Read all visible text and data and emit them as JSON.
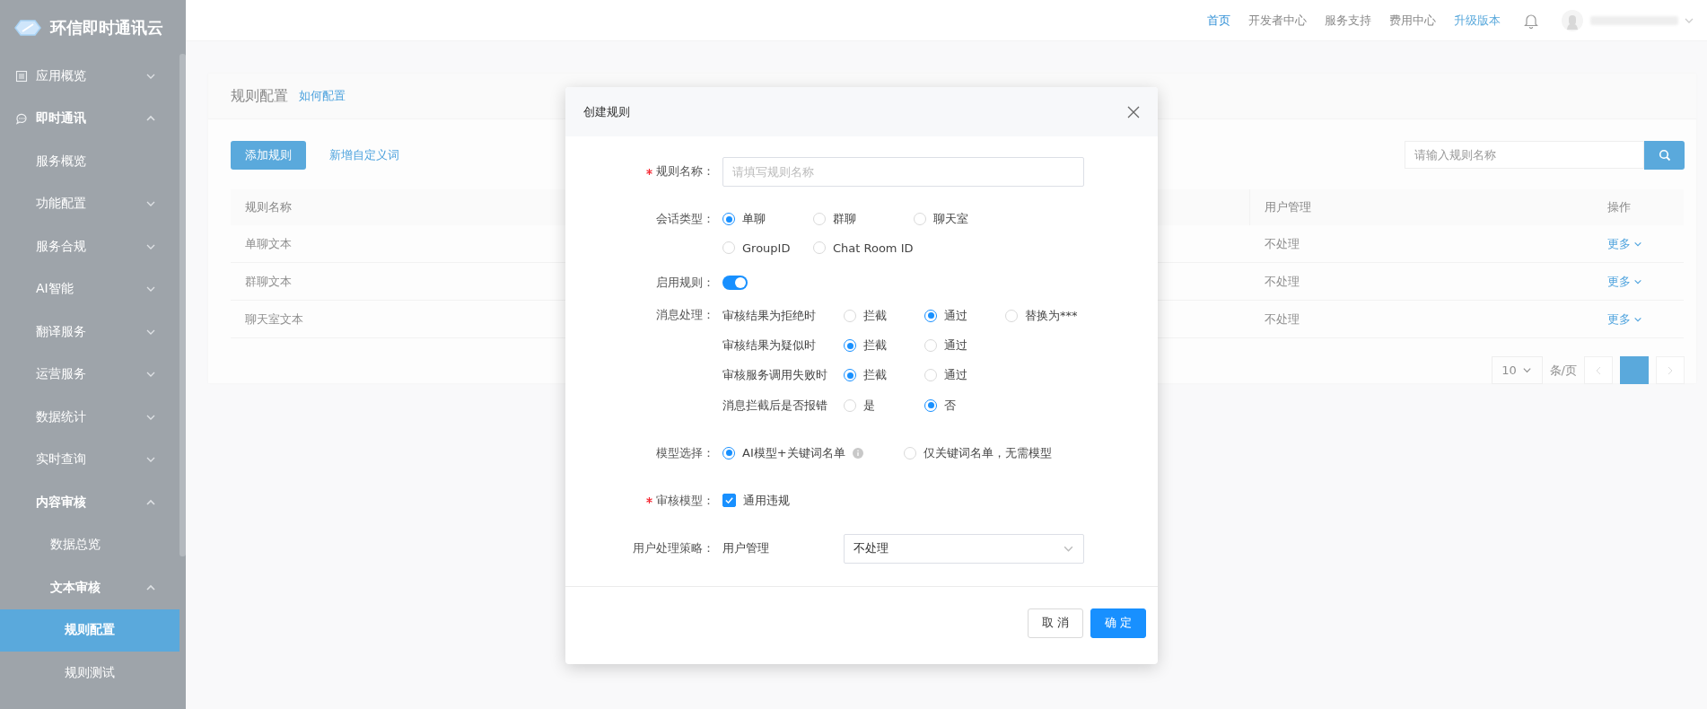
{
  "brand": {
    "name": "环信即时通讯云"
  },
  "sidebar": {
    "items": [
      {
        "label": "应用概览",
        "expanded": false,
        "selected": false
      },
      {
        "label": "即时通讯",
        "expanded": true,
        "selected": false,
        "children": [
          {
            "label": "服务概览",
            "selected": false
          },
          {
            "label": "功能配置",
            "expanded": false,
            "selected": false
          },
          {
            "label": "服务合规",
            "expanded": false,
            "selected": false
          },
          {
            "label": "AI智能",
            "expanded": false,
            "selected": false
          },
          {
            "label": "翻译服务",
            "expanded": false,
            "selected": false
          },
          {
            "label": "运营服务",
            "expanded": false,
            "selected": false
          },
          {
            "label": "数据统计",
            "expanded": false,
            "selected": false
          },
          {
            "label": "实时查询",
            "expanded": false,
            "selected": false
          },
          {
            "label": "内容审核",
            "expanded": true,
            "selected": false,
            "children": [
              {
                "label": "数据总览",
                "selected": false
              },
              {
                "label": "文本审核",
                "expanded": true,
                "selected": false,
                "children": [
                  {
                    "label": "规则配置",
                    "selected": true
                  },
                  {
                    "label": "规则测试",
                    "selected": false
                  }
                ]
              }
            ]
          }
        ]
      }
    ]
  },
  "topbar": {
    "links": [
      {
        "label": "首页",
        "kind": "nav",
        "selected": true
      },
      {
        "label": "开发者中心",
        "kind": "nav",
        "selected": false
      },
      {
        "label": "服务支持",
        "kind": "nav",
        "selected": false
      },
      {
        "label": "费用中心",
        "kind": "nav",
        "selected": false
      },
      {
        "label": "升级版本",
        "kind": "upgrade",
        "selected": false
      }
    ]
  },
  "page": {
    "title": "规则配置",
    "help_link": "如何配置",
    "add_button": "添加规则",
    "custom_words_link": "新增自定义词",
    "search": {
      "placeholder": "请输入规则名称"
    },
    "table": {
      "columns": [
        "规则名称",
        "用户管理",
        "操作"
      ],
      "rows": [
        {
          "cells": [
            "单聊文本",
            "不处理",
            "更多"
          ]
        },
        {
          "cells": [
            "群聊文本",
            "不处理",
            "更多"
          ]
        },
        {
          "cells": [
            "聊天室文本",
            "不处理",
            "更多"
          ]
        }
      ]
    },
    "pagination": {
      "page_size": "10",
      "per_page_label": "条/页"
    }
  },
  "modal": {
    "title": "创建规则",
    "fields": [
      {
        "kind": "text",
        "label": "规则名称：",
        "required": true,
        "placeholder": "请填写规则名称"
      },
      {
        "kind": "radio",
        "label": "会话类型：",
        "options": [
          {
            "label": "单聊",
            "selected": true
          },
          {
            "label": "群聊",
            "selected": false
          },
          {
            "label": "聊天室",
            "selected": false
          },
          {
            "label": "GroupID",
            "selected": false
          },
          {
            "label": "Chat Room ID",
            "selected": false
          }
        ]
      },
      {
        "kind": "switch",
        "label": "启用规则：",
        "on": true
      },
      {
        "kind": "matrix",
        "label": "消息处理：",
        "rows": [
          {
            "label": "审核结果为拒绝时",
            "options": [
              {
                "label": "拦截",
                "selected": false
              },
              {
                "label": "通过",
                "selected": true
              },
              {
                "label": "替换为***",
                "selected": false
              }
            ]
          },
          {
            "label": "审核结果为疑似时",
            "options": [
              {
                "label": "拦截",
                "selected": true
              },
              {
                "label": "通过",
                "selected": false
              }
            ]
          },
          {
            "label": "审核服务调用失败时",
            "options": [
              {
                "label": "拦截",
                "selected": true
              },
              {
                "label": "通过",
                "selected": false
              }
            ]
          },
          {
            "label": "消息拦截后是否报错",
            "options": [
              {
                "label": "是",
                "selected": false
              },
              {
                "label": "否",
                "selected": true
              }
            ]
          }
        ]
      },
      {
        "kind": "radio",
        "label": "模型选择：",
        "options": [
          {
            "label": "AI模型+关键词名单",
            "selected": true,
            "info": true
          },
          {
            "label": "仅关键词名单，无需模型",
            "selected": false
          }
        ]
      },
      {
        "kind": "checkbox",
        "label": "审核模型：",
        "required": true,
        "options": [
          {
            "label": "通用违规",
            "checked": true
          }
        ]
      },
      {
        "kind": "select",
        "label": "用户处理策略：",
        "sublabel": "用户管理",
        "value": "不处理"
      }
    ],
    "cancel": "取 消",
    "ok": "确 定"
  }
}
